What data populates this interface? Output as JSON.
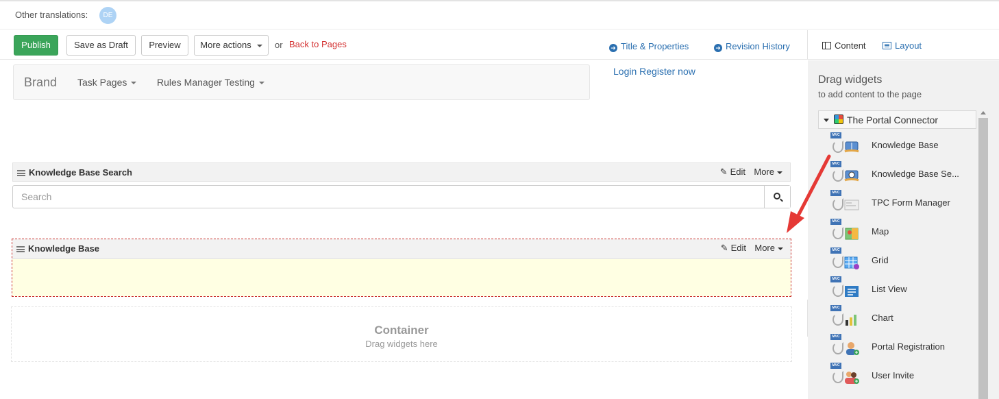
{
  "translations": {
    "label": "Other translations:",
    "badge": "DE"
  },
  "toolbar": {
    "publish": "Publish",
    "save_draft": "Save as Draft",
    "preview": "Preview",
    "more_actions": "More actions",
    "or": "or",
    "back": "Back to Pages",
    "title_props": "Title & Properties",
    "revision": "Revision History"
  },
  "sidetabs": {
    "content": "Content",
    "layout": "Layout"
  },
  "navbar": {
    "brand": "Brand",
    "task_pages": "Task Pages",
    "rules": "Rules Manager Testing",
    "login": "Login Register now"
  },
  "widget_search": {
    "title": "Knowledge Base Search",
    "edit": "Edit",
    "more": "More",
    "placeholder": "Search"
  },
  "widget_kb": {
    "title": "Knowledge Base",
    "edit": "Edit",
    "more": "More"
  },
  "container": {
    "title": "Container",
    "subtitle": "Drag widgets here"
  },
  "sidepanel": {
    "title": "Drag widgets",
    "subtitle": "to add content to the page",
    "group": "The Portal Connector",
    "widgets": [
      {
        "label": "Knowledge Base",
        "icon": "book-icon"
      },
      {
        "label": "Knowledge Base Se...",
        "icon": "book-search-icon"
      },
      {
        "label": "TPC Form Manager",
        "icon": "form-icon"
      },
      {
        "label": "Map",
        "icon": "map-icon"
      },
      {
        "label": "Grid",
        "icon": "grid-icon"
      },
      {
        "label": "List View",
        "icon": "list-view-icon"
      },
      {
        "label": "Chart",
        "icon": "chart-icon"
      },
      {
        "label": "Portal Registration",
        "icon": "registration-icon"
      },
      {
        "label": "User Invite",
        "icon": "user-invite-icon"
      }
    ]
  },
  "colors": {
    "publish": "#3ba55a",
    "link": "#2a6fb0",
    "back": "#d32f2f",
    "arrow": "#e53935",
    "dropzone": "#ffffe3"
  }
}
